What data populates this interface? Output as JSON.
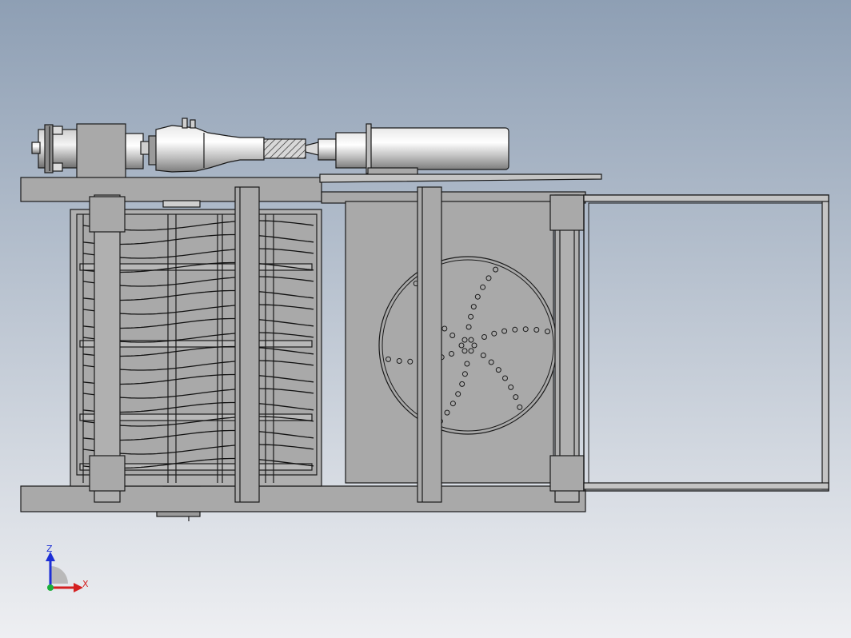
{
  "viewport": {
    "background_top": "#8e9fb4",
    "background_bottom": "#eeeff2",
    "part_fill": "#a9a9a9",
    "part_fill_light": "#c4c4c4",
    "edge_color": "#1a1a1a"
  },
  "triad": {
    "z_label": "Z",
    "x_label": "X",
    "z_color": "#1d2fd6",
    "x_color": "#d42020",
    "y_color": "#1bb03a"
  },
  "icons": [
    "triad-icon"
  ]
}
